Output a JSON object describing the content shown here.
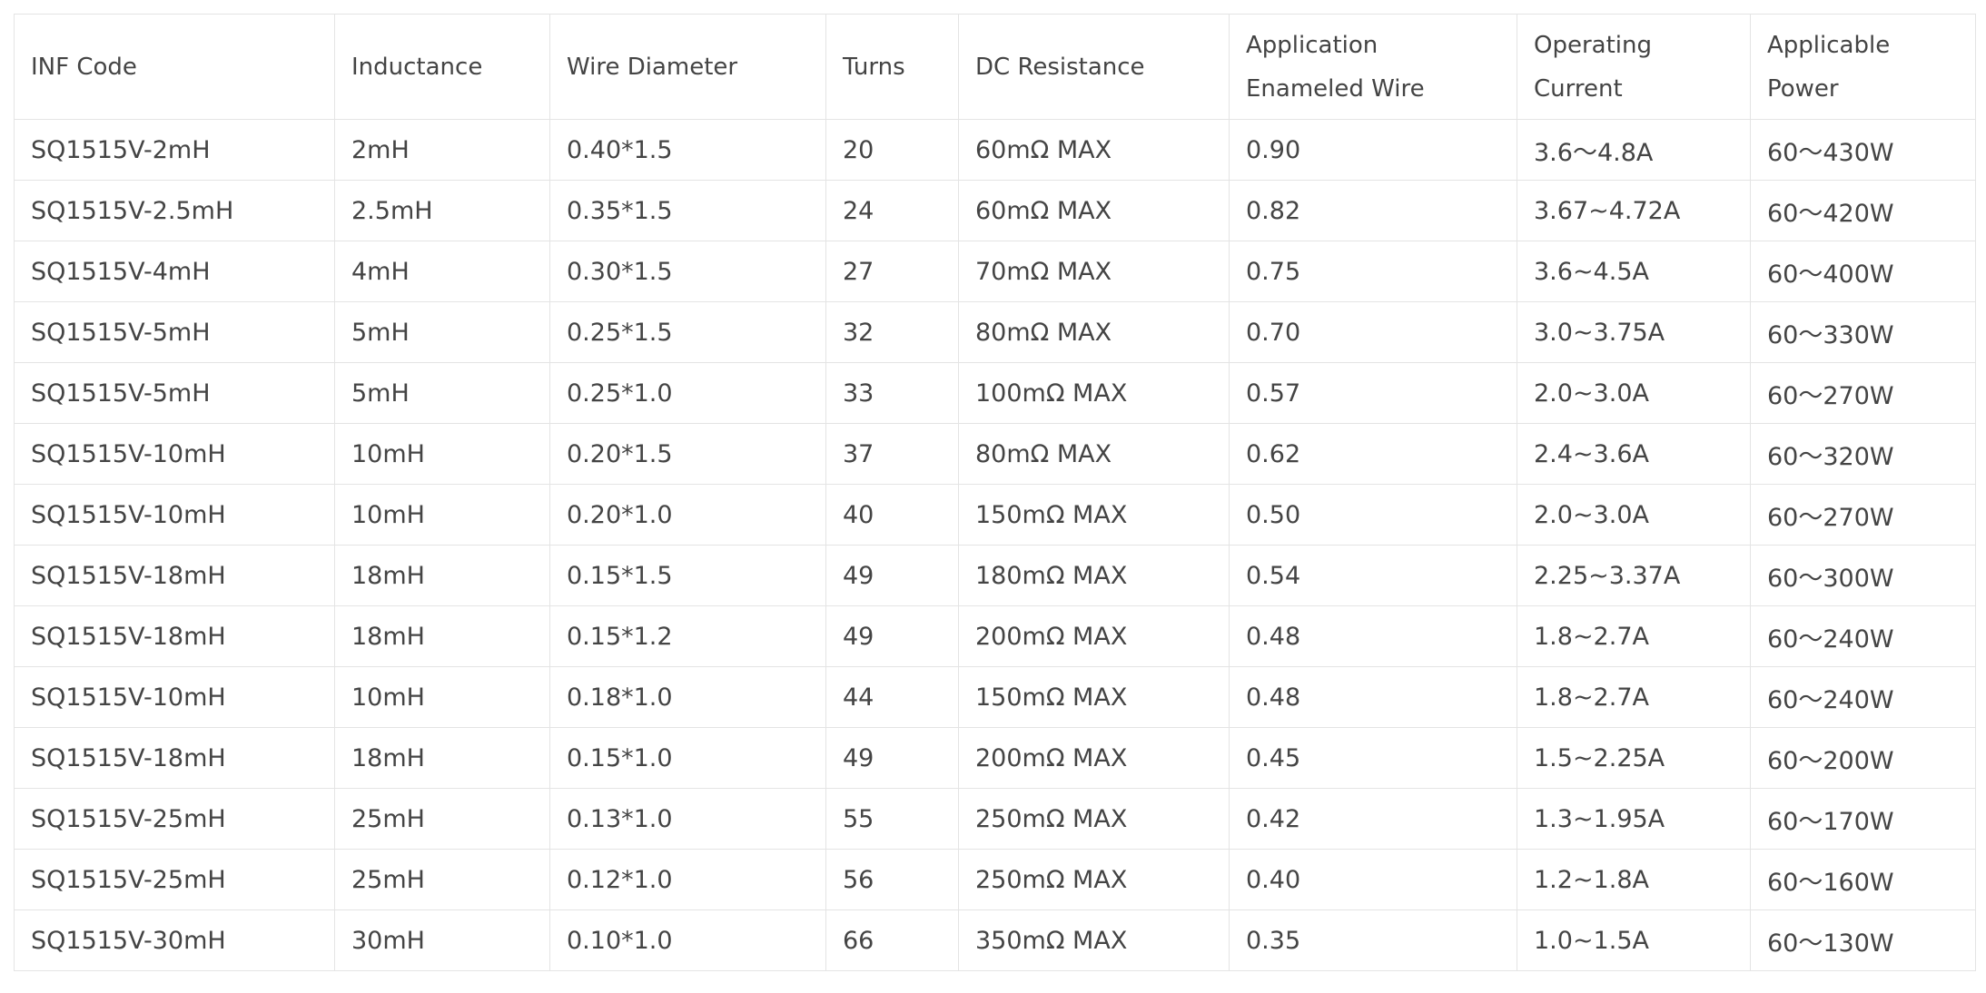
{
  "table": {
    "headers": [
      [
        "INF Code"
      ],
      [
        "Inductance"
      ],
      [
        "Wire Diameter"
      ],
      [
        "Turns"
      ],
      [
        "DC Resistance"
      ],
      [
        "Application",
        "Enameled Wire"
      ],
      [
        "Operating",
        "Current"
      ],
      [
        "Applicable",
        "Power"
      ]
    ],
    "rows": [
      [
        "SQ1515V-2mH",
        "2mH",
        "0.40*1.5",
        "20",
        "60mΩ MAX",
        "0.90",
        "3.6～4.8A",
        "60～430W"
      ],
      [
        "SQ1515V-2.5mH",
        "2.5mH",
        "0.35*1.5",
        "24",
        "60mΩ MAX",
        "0.82",
        "3.67~4.72A",
        "60～420W"
      ],
      [
        "SQ1515V-4mH",
        "4mH",
        "0.30*1.5",
        "27",
        "70mΩ MAX",
        "0.75",
        "3.6~4.5A",
        "60～400W"
      ],
      [
        "SQ1515V-5mH",
        "5mH",
        "0.25*1.5",
        "32",
        "80mΩ MAX",
        "0.70",
        "3.0~3.75A",
        "60～330W"
      ],
      [
        "SQ1515V-5mH",
        "5mH",
        "0.25*1.0",
        "33",
        "100mΩ MAX",
        "0.57",
        "2.0~3.0A",
        "60～270W"
      ],
      [
        "SQ1515V-10mH",
        "10mH",
        "0.20*1.5",
        "37",
        "80mΩ MAX",
        "0.62",
        "2.4~3.6A",
        "60～320W"
      ],
      [
        "SQ1515V-10mH",
        "10mH",
        "0.20*1.0",
        "40",
        "150mΩ MAX",
        "0.50",
        "2.0~3.0A",
        "60～270W"
      ],
      [
        "SQ1515V-18mH",
        "18mH",
        "0.15*1.5",
        "49",
        "180mΩ MAX",
        "0.54",
        "2.25~3.37A",
        "60～300W"
      ],
      [
        "SQ1515V-18mH",
        "18mH",
        "0.15*1.2",
        "49",
        "200mΩ MAX",
        "0.48",
        "1.8~2.7A",
        "60～240W"
      ],
      [
        "SQ1515V-10mH",
        "10mH",
        "0.18*1.0",
        "44",
        "150mΩ MAX",
        "0.48",
        "1.8~2.7A",
        "60～240W"
      ],
      [
        "SQ1515V-18mH",
        "18mH",
        "0.15*1.0",
        "49",
        "200mΩ MAX",
        "0.45",
        "1.5~2.25A",
        "60～200W"
      ],
      [
        "SQ1515V-25mH",
        "25mH",
        "0.13*1.0",
        "55",
        "250mΩ MAX",
        "0.42",
        "1.3~1.95A",
        "60～170W"
      ],
      [
        "SQ1515V-25mH",
        "25mH",
        "0.12*1.0",
        "56",
        "250mΩ MAX",
        "0.40",
        "1.2~1.8A",
        "60～160W"
      ],
      [
        "SQ1515V-30mH",
        "30mH",
        "0.10*1.0",
        "66",
        "350mΩ MAX",
        "0.35",
        "1.0~1.5A",
        "60～130W"
      ]
    ]
  }
}
